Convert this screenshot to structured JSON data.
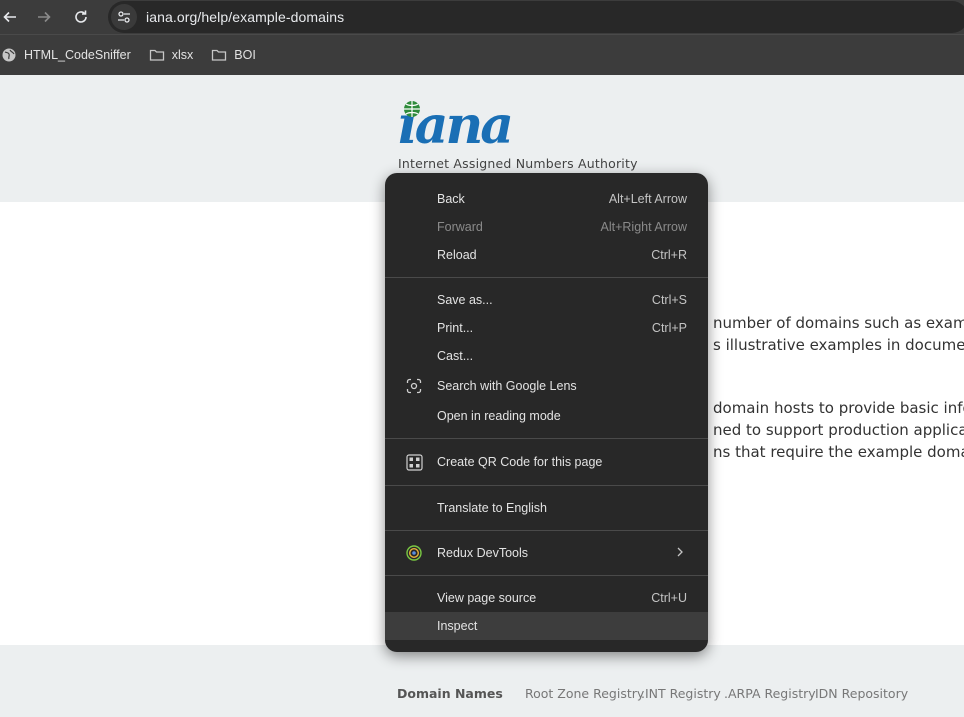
{
  "browser": {
    "url": "iana.org/help/example-domains",
    "bookmarks": [
      {
        "label": "HTML_CodeSniffer",
        "icon": "globe-icon"
      },
      {
        "label": "xlsx",
        "icon": "folder-icon"
      },
      {
        "label": "BOI",
        "icon": "folder-icon"
      }
    ]
  },
  "page": {
    "logo": "iana",
    "logo_subtitle": "Internet Assigned Numbers Authority",
    "paragraph_fragments": [
      "number of domains such as exam",
      "s illustrative examples in documen",
      "domain hosts to provide basic info",
      "ned to support production applicat",
      "ns that require the example doma"
    ],
    "footer": {
      "heading": "Domain Names",
      "links": [
        "Root Zone Registry",
        ".INT Registry",
        ".ARPA Registry",
        "IDN Repository"
      ]
    }
  },
  "context_menu": {
    "items": [
      {
        "label": "Back",
        "shortcut": "Alt+Left Arrow"
      },
      {
        "label": "Forward",
        "shortcut": "Alt+Right Arrow",
        "disabled": true
      },
      {
        "label": "Reload",
        "shortcut": "Ctrl+R"
      },
      {
        "label": "Save as...",
        "shortcut": "Ctrl+S"
      },
      {
        "label": "Print...",
        "shortcut": "Ctrl+P"
      },
      {
        "label": "Cast...",
        "shortcut": ""
      },
      {
        "label": "Search with Google Lens",
        "icon": "google-lens-icon"
      },
      {
        "label": "Open in reading mode"
      },
      {
        "label": "Create QR Code for this page",
        "icon": "qr-code-icon"
      },
      {
        "label": "Translate to English"
      },
      {
        "label": "Redux DevTools",
        "icon": "redux-devtools-icon",
        "submenu": true
      },
      {
        "label": "View page source",
        "shortcut": "Ctrl+U"
      },
      {
        "label": "Inspect",
        "highlighted": true
      }
    ]
  }
}
